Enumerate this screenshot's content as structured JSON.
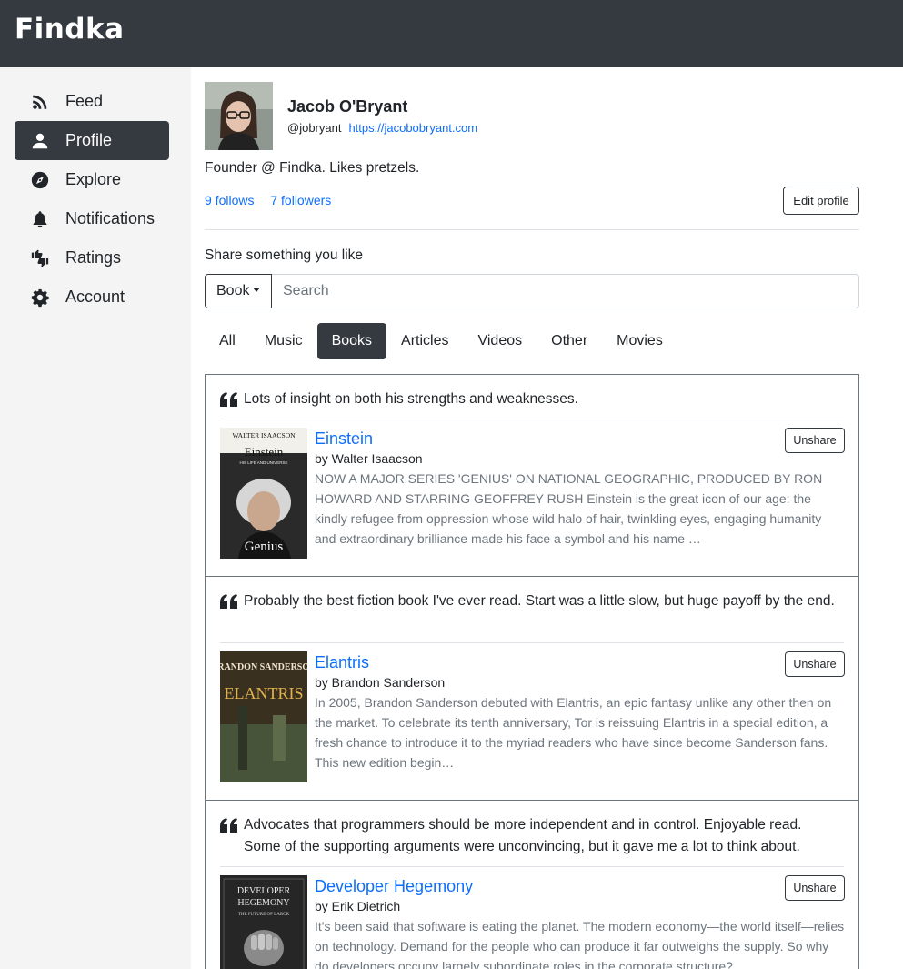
{
  "app": {
    "name": "Findka"
  },
  "nav": [
    {
      "label": "Feed",
      "icon": "rss-icon",
      "active": false
    },
    {
      "label": "Profile",
      "icon": "person-icon",
      "active": true
    },
    {
      "label": "Explore",
      "icon": "compass-icon",
      "active": false
    },
    {
      "label": "Notifications",
      "icon": "bell-icon",
      "active": false
    },
    {
      "label": "Ratings",
      "icon": "thumbs-icon",
      "active": false
    },
    {
      "label": "Account",
      "icon": "gear-icon",
      "active": false
    }
  ],
  "profile": {
    "name": "Jacob O'Bryant",
    "handle": "@jobryant",
    "website": "https://jacobobryant.com",
    "bio": "Founder @ Findka. Likes pretzels.",
    "follows": "9 follows",
    "followers": "7 followers",
    "edit_label": "Edit profile"
  },
  "share": {
    "label": "Share something you like",
    "type": "Book",
    "placeholder": "Search"
  },
  "tabs": [
    "All",
    "Music",
    "Books",
    "Articles",
    "Videos",
    "Other",
    "Movies"
  ],
  "active_tab": "Books",
  "unshare_label": "Unshare",
  "items": [
    {
      "comment": "Lots of insight on both his strengths and weaknesses.",
      "title": "Einstein",
      "author": "by Walter Isaacson",
      "description": "NOW A MAJOR SERIES 'GENIUS' ON NATIONAL GEOGRAPHIC, PRODUCED BY RON HOWARD AND STARRING GEOFFREY RUSH Einstein is the great icon of our age: the kindly refugee from oppression whose wild halo of hair, twinkling eyes, engaging humanity and extraordinary brilliance made his face a symbol and his name …",
      "cover": {
        "top_text": "WALTER ISAACSON",
        "title": "Einstein",
        "subtitle": "HIS LIFE AND UNIVERSE",
        "bottom": "Genius"
      }
    },
    {
      "comment": "Probably the best fiction book I've ever read. Start was a little slow, but huge payoff by the end.",
      "title": "Elantris",
      "author": "by Brandon Sanderson",
      "description": "In 2005, Brandon Sanderson debuted with Elantris, an epic fantasy unlike any other then on the market. To celebrate its tenth anniversary, Tor is reissuing Elantris in a special edition, a fresh chance to introduce it to the myriad readers who have since become Sanderson fans. This new edition begin…",
      "cover": {
        "top_text": "BRANDON SANDERSON",
        "title": "ELANTRIS"
      }
    },
    {
      "comment": "Advocates that programmers should be more independent and in control. Enjoyable read. Some of the supporting arguments were unconvincing, but it gave me a lot to think about.",
      "title": "Developer Hegemony",
      "author": "by Erik Dietrich",
      "description": "It's been said that software is eating the planet. The modern economy—the world itself—relies on technology. Demand for the people who can produce it far outweighs the supply. So why do developers occupy largely subordinate roles in the corporate structure?",
      "cover": {
        "top_text": "DEVELOPER",
        "title": "HEGEMONY",
        "subtitle": "THE FUTURE OF LABOR"
      }
    }
  ]
}
